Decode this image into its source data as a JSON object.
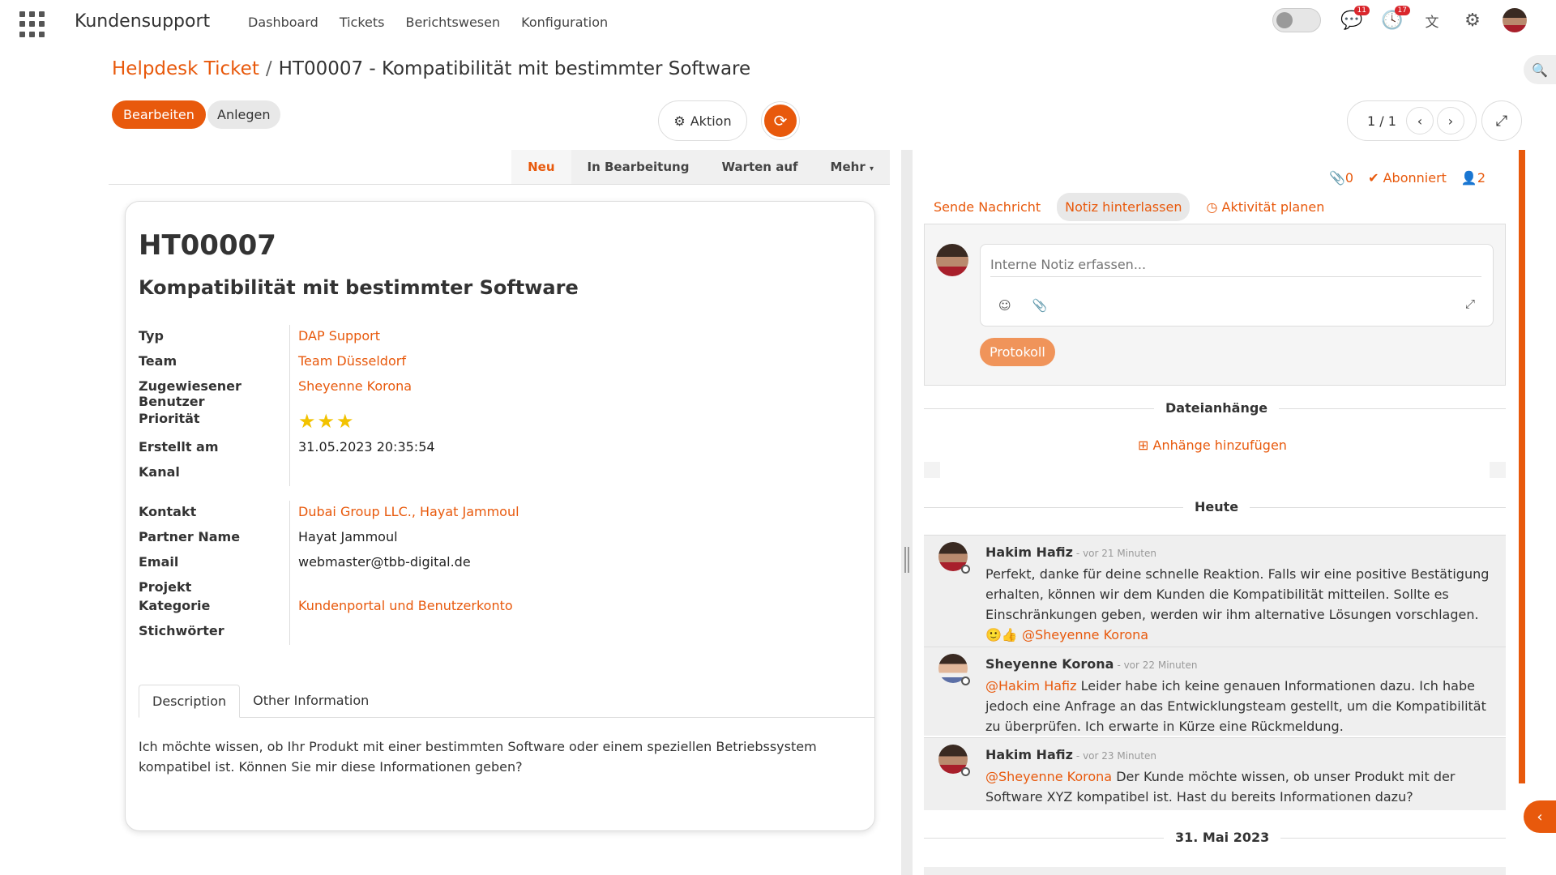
{
  "topbar": {
    "app_title": "Kundensupport",
    "nav": [
      "Dashboard",
      "Tickets",
      "Berichtswesen",
      "Konfiguration"
    ],
    "chat_count": "11",
    "activity_count": "17"
  },
  "breadcrumb": {
    "parent": "Helpdesk Ticket",
    "separator": "/",
    "current": "HT00007 - Kompatibilität mit bestimmter Software"
  },
  "toolbar": {
    "edit_label": "Bearbeiten",
    "create_label": "Anlegen",
    "action_label": "Aktion",
    "pager": "1 / 1"
  },
  "stages": [
    "Neu",
    "In Bearbeitung",
    "Warten auf",
    "Mehr"
  ],
  "ticket": {
    "number": "HT00007",
    "subject": "Kompatibilität mit bestimmter Software",
    "fields": {
      "typ_label": "Typ",
      "typ": "DAP Support",
      "team_label": "Team",
      "team": "Team Düsseldorf",
      "assigned_label": "Zugewiesener Benutzer",
      "assigned": "Sheyenne Korona",
      "priority_label": "Priorität",
      "priority_stars": 3,
      "created_label": "Erstellt am",
      "created": "31.05.2023 20:35:54",
      "channel_label": "Kanal",
      "channel": "",
      "contact_label": "Kontakt",
      "contact": "Dubai Group LLC., Hayat Jammoul",
      "partner_label": "Partner Name",
      "partner": "Hayat Jammoul",
      "email_label": "Email",
      "email": "webmaster@tbb-digital.de",
      "project_label": "Projekt",
      "project": "",
      "category_label": "Kategorie",
      "category": "Kundenportal und Benutzerkonto",
      "tags_label": "Stichwörter",
      "tags": ""
    },
    "tabs": [
      "Description",
      "Other Information"
    ],
    "description": "Ich möchte wissen, ob Ihr Produkt mit einer bestimmten Software oder einem speziellen Betriebssystem kompatibel ist. Können Sie mir diese Informationen geben?"
  },
  "chatter": {
    "attachments_count": "0",
    "subscribed_label": "Abonniert",
    "followers_count": "2",
    "tabs": [
      "Sende Nachricht",
      "Notiz hinterlassen",
      "Aktivität planen"
    ],
    "note_placeholder": "Interne Notiz erfassen...",
    "log_label": "Protokoll",
    "attachments_title": "Dateianhänge",
    "add_attachment": "Anhänge hinzufügen",
    "today_label": "Heute",
    "older_label": "31. Mai 2023",
    "messages": [
      {
        "author": "Hakim Hafiz",
        "when": "- vor 21 Minuten",
        "text": "Perfekt, danke für deine schnelle Reaktion. Falls wir eine positive Bestätigung erhalten, können wir dem Kunden die Kompatibilität mitteilen. Sollte es Einschränkungen geben, werden wir ihm alternative Lösungen vorschlagen.",
        "emoji": "🙂👍",
        "mention": "@Sheyenne Korona"
      },
      {
        "author": "Sheyenne Korona",
        "when": "- vor 22 Minuten",
        "mention": "@Hakim Hafiz",
        "text": "Leider habe ich keine genauen Informationen dazu. Ich habe jedoch eine Anfrage an das Entwicklungsteam gestellt, um die Kompatibilität zu überprüfen. Ich erwarte in Kürze eine Rückmeldung."
      },
      {
        "author": "Hakim Hafiz",
        "when": "- vor 23 Minuten",
        "mention": "@Sheyenne Korona",
        "text": "Der Kunde möchte wissen, ob unser Produkt mit der Software XYZ kompatibel ist. Hast du bereits Informationen dazu?"
      }
    ]
  },
  "colors": {
    "accent": "#e8590c",
    "star": "#f2c200"
  }
}
